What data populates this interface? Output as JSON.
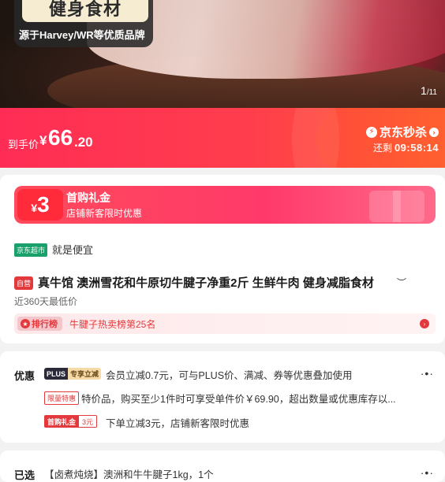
{
  "hero": {
    "promo_title": "健身食材",
    "promo_sub": "源于Harvey/WR等优质品牌",
    "page_current": "1",
    "page_total": "/11"
  },
  "price": {
    "label": "到手价",
    "currency": "¥",
    "integer": "66",
    "decimal": ".20",
    "flash_label": "京东秒杀",
    "countdown_prefix": "还剩",
    "countdown": "09:58:14"
  },
  "coupon": {
    "currency": "¥",
    "amount": "3",
    "title": "首购礼金",
    "subtitle": "店铺新客限时优惠"
  },
  "store": {
    "tag": "京东超市",
    "slogan": "就是便宜"
  },
  "product": {
    "self_tag": "自营",
    "title": "真牛馆 澳洲雪花和牛原切牛腱子净重2斤 生鲜牛肉 健身减脂食材",
    "lowest_note": "近360天最低价"
  },
  "rank": {
    "badge": "排行榜",
    "text": "牛腱子热卖榜第25名"
  },
  "promo": {
    "label": "优惠",
    "plus_a": "PLUS",
    "plus_b": "专享立减",
    "row1": "会员立减0.7元，可与PLUS价、满减、券等优惠叠加使用",
    "limit_tag": "限量特惠",
    "row2": "特价品，购买至少1件时可享受单件价￥69.90，超出数量或优惠库存以...",
    "gift_a": "首购礼金",
    "gift_b": "3元",
    "row3": "下单立减3元，店铺新客限时优惠"
  },
  "selected": {
    "label": "已选",
    "text": "【卤煮炖烧】澳洲和牛牛腱子1kg，1个"
  },
  "colors": {
    "accent": "#e4393c",
    "price_bar_start": "#ff2d55",
    "price_bar_end": "#ff5a2c",
    "store_green": "#1aa06a"
  }
}
